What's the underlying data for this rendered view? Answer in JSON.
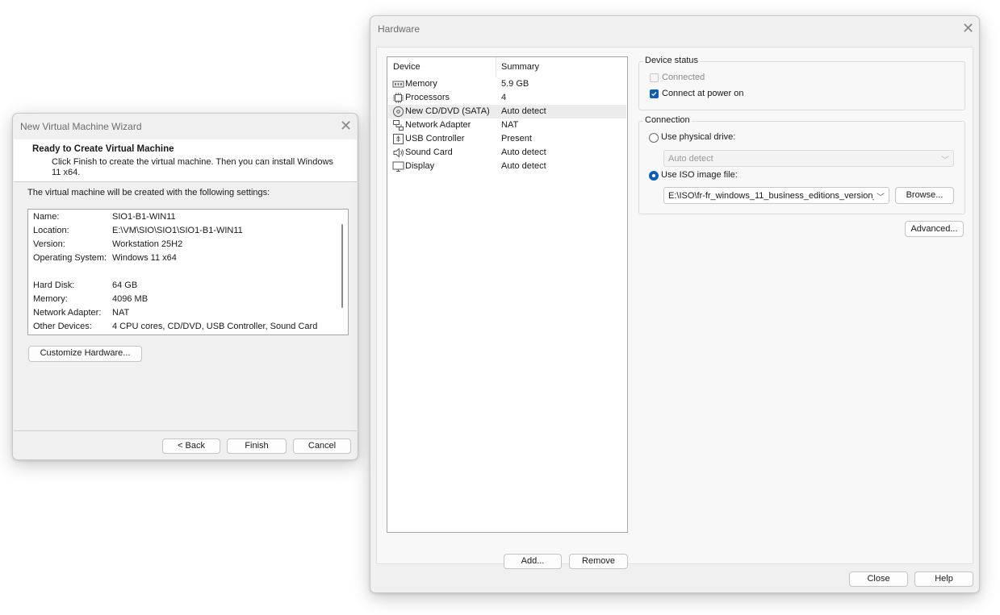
{
  "wizard": {
    "title": "New Virtual Machine Wizard",
    "heading": "Ready to Create Virtual Machine",
    "subtext": "Click Finish to create the virtual machine. Then you can install Windows 11 x64.",
    "intro": "The virtual machine will be created with the following settings:",
    "settings": [
      {
        "key": "Name:",
        "value": "SIO1-B1-WIN11"
      },
      {
        "key": "Location:",
        "value": "E:\\VM\\SIO\\SIO1\\SIO1-B1-WIN11"
      },
      {
        "key": "Version:",
        "value": "Workstation 25H2"
      },
      {
        "key": "Operating System:",
        "value": "Windows 11 x64"
      },
      {
        "key": "Hard Disk:",
        "value": "64 GB"
      },
      {
        "key": "Memory:",
        "value": "4096 MB"
      },
      {
        "key": "Network Adapter:",
        "value": "NAT"
      },
      {
        "key": "Other Devices:",
        "value": "4 CPU cores, CD/DVD, USB Controller, Sound Card"
      }
    ],
    "customize_label": "Customize Hardware...",
    "back_label": "< Back",
    "finish_label": "Finish",
    "cancel_label": "Cancel"
  },
  "hardware": {
    "title": "Hardware",
    "columns": {
      "device": "Device",
      "summary": "Summary"
    },
    "devices": [
      {
        "name": "Memory",
        "summary": "5.9 GB",
        "icon": "memory-icon"
      },
      {
        "name": "Processors",
        "summary": "4",
        "icon": "processor-icon"
      },
      {
        "name": "New CD/DVD (SATA)",
        "summary": "Auto detect",
        "icon": "cd-dvd-icon",
        "selected": true
      },
      {
        "name": "Network Adapter",
        "summary": "NAT",
        "icon": "network-adapter-icon"
      },
      {
        "name": "USB Controller",
        "summary": "Present",
        "icon": "usb-icon"
      },
      {
        "name": "Sound Card",
        "summary": "Auto detect",
        "icon": "sound-icon"
      },
      {
        "name": "Display",
        "summary": "Auto detect",
        "icon": "display-icon"
      }
    ],
    "add_label": "Add...",
    "remove_label": "Remove",
    "device_status": {
      "title": "Device status",
      "connected_label": "Connected",
      "connected_checked": false,
      "power_on_label": "Connect at power on",
      "power_on_checked": true
    },
    "connection": {
      "title": "Connection",
      "physical_label": "Use physical drive:",
      "physical_value": "Auto detect",
      "iso_label": "Use ISO image file:",
      "iso_value": "E:\\ISO\\fr-fr_windows_11_business_editions_version_",
      "browse_label": "Browse...",
      "selected": "iso"
    },
    "advanced_label": "Advanced...",
    "close_label": "Close",
    "help_label": "Help"
  },
  "colors": {
    "accent": "#0a5fb4",
    "selected_row": "#ececec"
  }
}
